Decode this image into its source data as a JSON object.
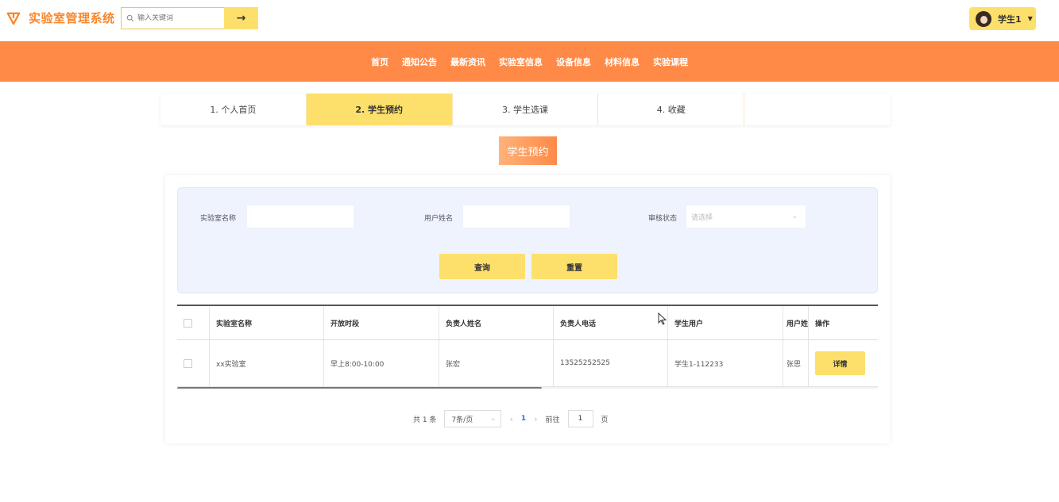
{
  "app": {
    "title": "实验室管理系统",
    "search_placeholder": "输入关键词",
    "search_button": "→",
    "user_name": "学生1",
    "brand_color": "#f7872e",
    "accent_color": "#fde06b",
    "nav_color": "#ff8a47"
  },
  "nav": {
    "items": [
      "首页",
      "通知公告",
      "最新资讯",
      "实验室信息",
      "设备信息",
      "材料信息",
      "实验课程"
    ]
  },
  "tabs": [
    {
      "label": "1. 个人首页",
      "active": false
    },
    {
      "label": "2. 学生预约",
      "active": true
    },
    {
      "label": "3. 学生选课",
      "active": false
    },
    {
      "label": "4. 收藏",
      "active": false
    },
    {
      "label": "",
      "active": false
    }
  ],
  "section_title": "学生预约",
  "filters": {
    "lab_name_label": "实验室名称",
    "lab_name_value": "",
    "user_name_label": "用户姓名",
    "user_name_value": "",
    "status_label": "审核状态",
    "status_placeholder": "请选择",
    "query_button": "查询",
    "reset_button": "重置"
  },
  "table": {
    "columns": [
      "实验室名称",
      "开放时段",
      "负责人姓名",
      "负责人电话",
      "学生用户",
      "用户姓",
      "操作"
    ],
    "rows": [
      {
        "lab_name": "xx实验室",
        "open_period": "早上8:00-10:00",
        "manager_name": "张宏",
        "manager_phone": "13525252525",
        "student_user": "学生1-112233",
        "user_name": "张思",
        "action": "详情"
      }
    ],
    "scroll_fraction": 0.52
  },
  "pagination": {
    "total": "共 1 条",
    "page_size": "7条/页",
    "current_page": "1",
    "goto_label": "前往",
    "goto_value": "1",
    "page_suffix": "页"
  }
}
